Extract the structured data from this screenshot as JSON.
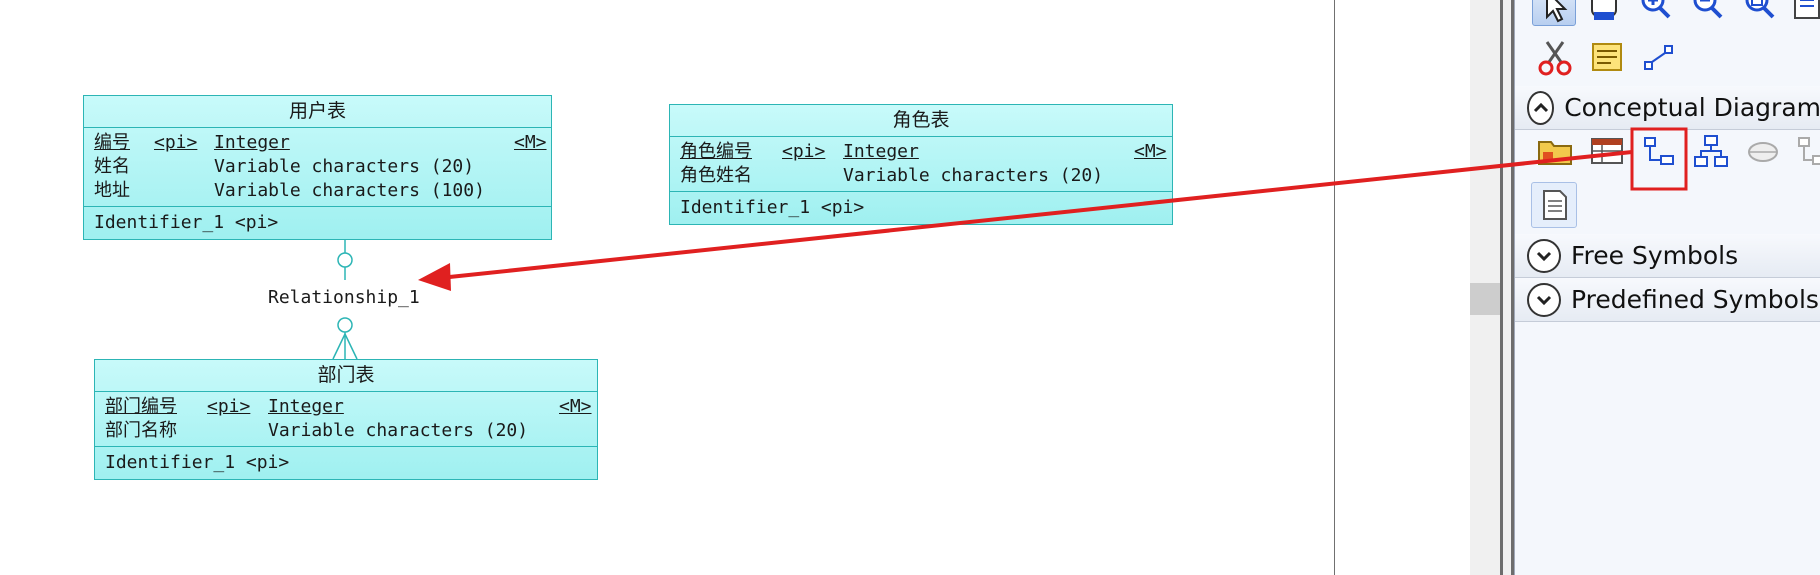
{
  "diagram": {
    "entities": [
      {
        "title": "用户表",
        "attributes": [
          {
            "name": "编号",
            "pk": "<pi>",
            "type": "Integer",
            "mandatory": "<M>"
          },
          {
            "name": "姓名",
            "pk": "",
            "type": "Variable characters (20)",
            "mandatory": ""
          },
          {
            "name": "地址",
            "pk": "",
            "type": "Variable characters (100)",
            "mandatory": ""
          }
        ],
        "identifier": "Identifier_1  <pi>"
      },
      {
        "title": "角色表",
        "attributes": [
          {
            "name": "角色编号",
            "pk": "<pi>",
            "type": "Integer",
            "mandatory": "<M>"
          },
          {
            "name": "角色姓名",
            "pk": "",
            "type": "Variable characters (20)",
            "mandatory": ""
          }
        ],
        "identifier": "Identifier_1  <pi>"
      },
      {
        "title": "部门表",
        "attributes": [
          {
            "name": "部门编号",
            "pk": "<pi>",
            "type": "Integer",
            "mandatory": "<M>"
          },
          {
            "name": "部门名称",
            "pk": "",
            "type": "Variable characters (20)",
            "mandatory": ""
          }
        ],
        "identifier": "Identifier_1  <pi>"
      }
    ],
    "relationship_label": "Relationship_1"
  },
  "toolbox": {
    "sections": [
      {
        "label": "Conceptual Diagram",
        "state": "expanded"
      },
      {
        "label": "Free Symbols",
        "state": "collapsed"
      },
      {
        "label": "Predefined Symbols",
        "state": "collapsed"
      }
    ],
    "icons": [
      "pointer-icon",
      "hand-icon",
      "zoom-in-icon",
      "zoom-out-icon",
      "zoom-fit-icon",
      "page-icon",
      "cut-icon",
      "notes-icon",
      "link-icon",
      "package-icon",
      "entity-icon",
      "relationship-icon",
      "inheritance-icon",
      "association-icon",
      "association-link-icon",
      "file-icon"
    ]
  },
  "colors": {
    "entity_fill": "#b4f5f5",
    "entity_border": "#2cb5b5",
    "arrow": "#e02020",
    "highlight_box": "#e02020"
  }
}
